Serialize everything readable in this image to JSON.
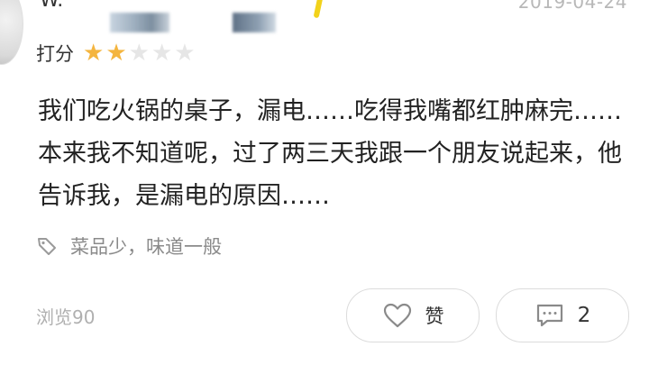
{
  "review": {
    "username": "W.",
    "date": "2019-04-24",
    "rating_label": "打分",
    "rating": {
      "value": 2,
      "max": 5
    },
    "content": "我们吃火锅的桌子，漏电……吃得我嘴都红肿麻完……本来我不知道呢，过了两三天我跟一个朋友说起来，他告诉我，是漏电的原因……",
    "tag": "菜品少，味道一般",
    "views": "浏览90",
    "like_label": "赞",
    "comment_count": "2"
  },
  "icons": {
    "tag": "tag-icon",
    "like": "heart-icon",
    "comment": "comment-icon",
    "star": "star-icon"
  },
  "colors": {
    "star_on": "#f4b53f",
    "star_off": "#e6e6e6",
    "muted": "#b0b0b0"
  }
}
